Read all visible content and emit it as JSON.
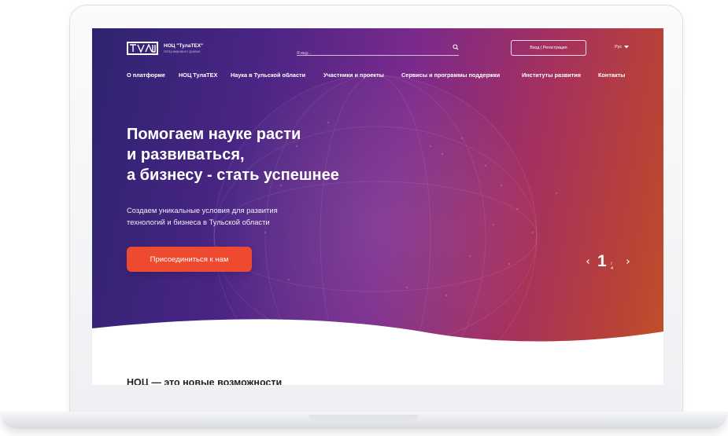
{
  "header": {
    "logo_title": "НОЦ \"ТулаТЕХ\"",
    "logo_subtitle": "НОЦ мирового уровня",
    "search_placeholder": "Я ищу...",
    "login_label": "Вход | Регистрация",
    "language": "Рус"
  },
  "nav": {
    "items": [
      "О платформе",
      "НОЦ ТулаТЕХ",
      "Наука в Тульской области",
      "Участники и проекты",
      "Сервисы и программы поддержки",
      "Институты развития",
      "Контакты"
    ]
  },
  "hero": {
    "headline": [
      "Помогаем науке расти",
      "и развиваться,",
      "а бизнесу - стать успешнее"
    ],
    "subtext": [
      "Создаем уникальные условия для развития",
      "технологий и бизнеса в Тульской области"
    ],
    "cta_label": "Присоединиться к нам"
  },
  "slider": {
    "current": "1",
    "total": "/ 4"
  },
  "section": {
    "title": "НОЦ — это новые возможности"
  },
  "colors": {
    "hero_start": "#2e2370",
    "hero_mid": "#7a2a8c",
    "hero_end": "#c0502a",
    "cta": "#ee4a30"
  }
}
